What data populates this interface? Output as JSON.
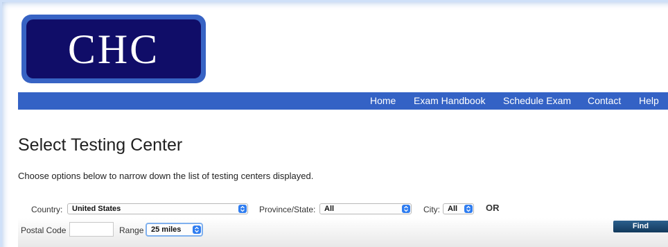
{
  "logo": {
    "text": "CHC"
  },
  "nav": {
    "items": [
      {
        "label": "Home"
      },
      {
        "label": "Exam Handbook"
      },
      {
        "label": "Schedule Exam"
      },
      {
        "label": "Contact"
      },
      {
        "label": "Help"
      }
    ]
  },
  "page": {
    "title": "Select Testing Center",
    "intro": "Choose options below to narrow down the list of testing centers displayed."
  },
  "filters": {
    "country_label": "Country:",
    "country_value": "United States",
    "province_label": "Province/State:",
    "province_value": "All",
    "city_label": "City:",
    "city_value": "All",
    "or_text": "OR",
    "postal_label": "Postal Code",
    "postal_value": "",
    "range_label": "Range",
    "range_value": "25 miles",
    "find_label": "Find"
  },
  "colors": {
    "nav_bar": "#3462c5",
    "logo_outer": "#3763c4",
    "logo_inner": "#100d68",
    "select_arrow": "#2f7df0",
    "find_button": "#1d4a72"
  }
}
